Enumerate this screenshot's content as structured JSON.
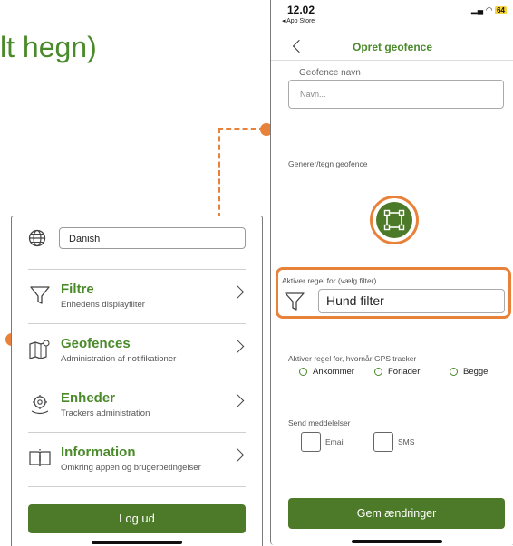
{
  "page_title_fragment": "lt hegn)",
  "colors": {
    "brand_green": "#4a8a2a",
    "button_green": "#4d7a28",
    "highlight_orange": "#e8823b"
  },
  "left_screen": {
    "language_value": "Danish",
    "menu": [
      {
        "title": "Filtre",
        "subtitle": "Enhedens displayfilter",
        "icon": "funnel-icon"
      },
      {
        "title": "Geofences",
        "subtitle": "Administration af notifikationer",
        "icon": "map-icon"
      },
      {
        "title": "Enheder",
        "subtitle": "Trackers administration",
        "icon": "tracker-icon"
      },
      {
        "title": "Information",
        "subtitle": "Omkring appen og brugerbetingelser",
        "icon": "book-icon"
      }
    ],
    "logout_label": "Log ud"
  },
  "right_screen": {
    "status": {
      "time": "12.02",
      "back_app": "◂ App Store",
      "battery": "64"
    },
    "nav_title": "Opret geofence",
    "geofence_name_label": "Geofence navn",
    "name_placeholder": "Navn...",
    "draw_label": "Generer/tegn geofence",
    "filter_rule_label": "Aktiver regel for (vælg filter)",
    "filter_value": "Hund filter",
    "gps_rule_label": "Aktiver regel for, hvornår GPS tracker",
    "radio_options": [
      "Ankommer",
      "Forlader",
      "Begge"
    ],
    "notify_label": "Send meddelelser",
    "notify_options": [
      "Email",
      "SMS"
    ],
    "save_label": "Gem ændringer"
  }
}
